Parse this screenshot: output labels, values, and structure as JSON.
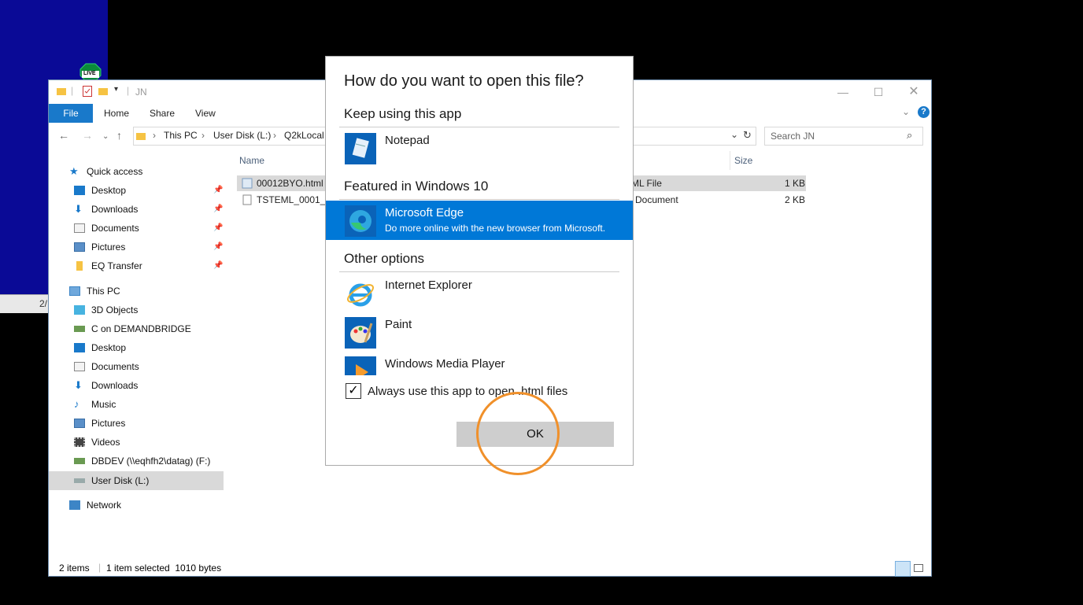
{
  "background": {
    "strip_text": "2/",
    "live_label": "LIVE"
  },
  "explorer": {
    "title": "JN",
    "ribbon_tabs": [
      "File",
      "Home",
      "Share",
      "View"
    ],
    "breadcrumb": [
      "This PC",
      "User Disk (L:)",
      "Q2kLocal"
    ],
    "search_placeholder": "Search JN",
    "nav": {
      "quick_access": "Quick access",
      "quick_items": [
        "Desktop",
        "Downloads",
        "Documents",
        "Pictures",
        "EQ Transfer"
      ],
      "this_pc": "This PC",
      "pc_items": [
        "3D Objects",
        "C on DEMANDBRIDGE",
        "Desktop",
        "Documents",
        "Downloads",
        "Music",
        "Pictures",
        "Videos",
        "DBDEV (\\\\eqhfh2\\datag) (F:)",
        "User Disk (L:)"
      ],
      "network": "Network"
    },
    "columns": {
      "name": "Name",
      "size": "Size"
    },
    "files": [
      {
        "name": "00012BYO.html",
        "type": "ML File",
        "size": "1 KB"
      },
      {
        "name": "TSTEML_0001_JN",
        "type": "Document",
        "size": "2 KB"
      }
    ],
    "status": {
      "items": "2 items",
      "selected": "1 item selected  1010 bytes"
    }
  },
  "dialog": {
    "title": "How do you want to open this file?",
    "keep_using": "Keep using this app",
    "notepad": "Notepad",
    "featured": "Featured in Windows 10",
    "edge_name": "Microsoft Edge",
    "edge_desc": "Do more online with the new browser from Microsoft.",
    "other": "Other options",
    "ie": "Internet Explorer",
    "paint": "Paint",
    "wmp": "Windows Media Player",
    "always_use": "Always use this app to open .html files",
    "always_checked": true,
    "ok": "OK"
  }
}
